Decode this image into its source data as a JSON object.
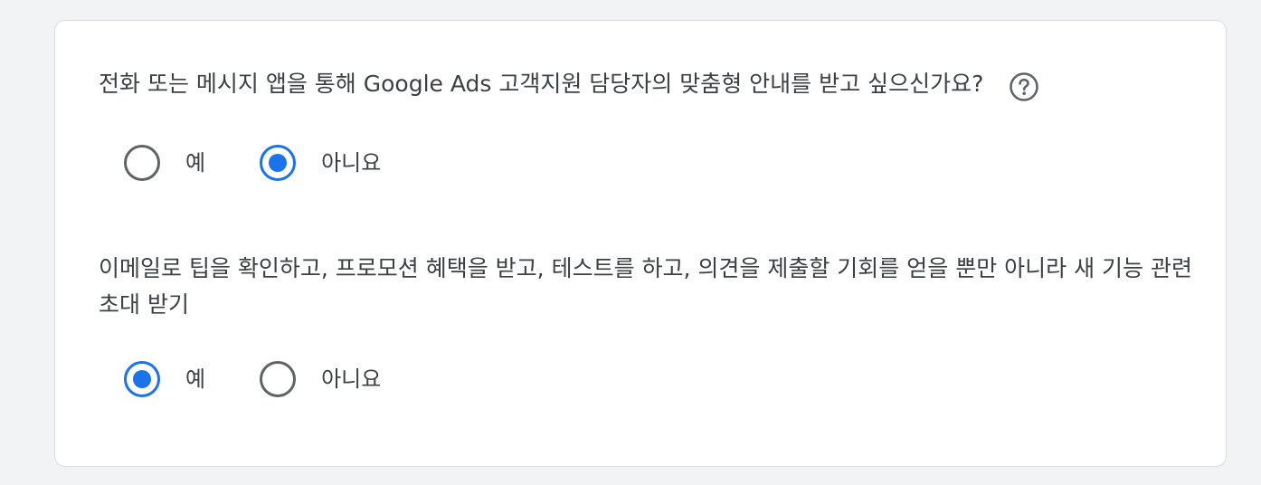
{
  "question1": {
    "text": "전화 또는 메시지 앱을 통해 Google Ads 고객지원 담당자의 맞춤형 안내를 받고 싶으신가요?",
    "help_icon": "help-circle-icon",
    "options": [
      {
        "label": "예",
        "checked": false
      },
      {
        "label": "아니요",
        "checked": true
      }
    ]
  },
  "question2": {
    "text": "이메일로 팁을 확인하고, 프로모션 혜택을 받고, 테스트를 하고, 의견을 제출할 기회를 얻을 뿐만 아니라 새 기능 관련 초대 받기",
    "options": [
      {
        "label": "예",
        "checked": true
      },
      {
        "label": "아니요",
        "checked": false
      }
    ]
  },
  "colors": {
    "accent": "#1a73e8",
    "unchecked_border": "#5f6368",
    "text": "#3c4043",
    "background": "#f1f3f4",
    "card_border": "#dadce0"
  }
}
